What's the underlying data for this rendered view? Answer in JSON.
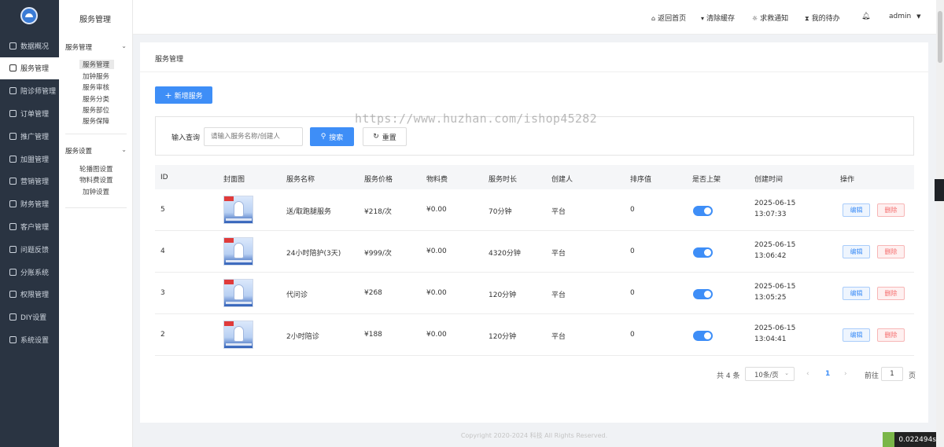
{
  "nav": {
    "items": [
      {
        "label": "数据概况",
        "icon": "dashboard-icon"
      },
      {
        "label": "服务管理",
        "icon": "service-icon"
      },
      {
        "label": "陪诊师管理",
        "icon": "doctor-icon"
      },
      {
        "label": "订单管理",
        "icon": "order-icon"
      },
      {
        "label": "推广管理",
        "icon": "promotion-icon"
      },
      {
        "label": "加盟管理",
        "icon": "franchise-icon"
      },
      {
        "label": "营销管理",
        "icon": "marketing-icon"
      },
      {
        "label": "财务管理",
        "icon": "finance-icon"
      },
      {
        "label": "客户管理",
        "icon": "customer-icon"
      },
      {
        "label": "问题反馈",
        "icon": "feedback-icon"
      },
      {
        "label": "分账系统",
        "icon": "split-icon"
      },
      {
        "label": "权限管理",
        "icon": "permission-icon"
      },
      {
        "label": "DIY设置",
        "icon": "diy-icon"
      },
      {
        "label": "系统设置",
        "icon": "settings-icon"
      }
    ],
    "active_index": 1
  },
  "subnav": {
    "title": "服务管理",
    "group1": {
      "label": "服务管理",
      "items": [
        "服务管理",
        "加钟服务",
        "服务审核",
        "服务分类",
        "服务部位",
        "服务保障"
      ]
    },
    "group2": {
      "label": "服务设置",
      "items": [
        "轮播图设置",
        "物料费设置",
        "加钟设置"
      ]
    }
  },
  "header": {
    "home": "返回首页",
    "clear_cache": "清除缓存",
    "help": "求救通知",
    "todo": "我的待办",
    "user": "admin"
  },
  "breadcrumb": "服务管理",
  "toolbar": {
    "add_label": "新增服务"
  },
  "search": {
    "label": "输入查询",
    "placeholder": "请输入服务名称/创建人",
    "search_label": "搜索",
    "reset_label": "重置"
  },
  "watermark": "https://www.huzhan.com/ishop45282",
  "table": {
    "columns": [
      "ID",
      "封面图",
      "服务名称",
      "服务价格",
      "物料费",
      "服务时长",
      "创建人",
      "排序值",
      "是否上架",
      "创建时间",
      "操作"
    ],
    "rows": [
      {
        "id": "5",
        "name": "送/取跑腿服务",
        "price": "¥218/次",
        "material": "¥0.00",
        "duration": "70分钟",
        "creator": "平台",
        "sort": "0",
        "date": "2025-06-15",
        "time": "13:07:33"
      },
      {
        "id": "4",
        "name": "24小时陪护(3天)",
        "price": "¥999/次",
        "material": "¥0.00",
        "duration": "4320分钟",
        "creator": "平台",
        "sort": "0",
        "date": "2025-06-15",
        "time": "13:06:42"
      },
      {
        "id": "3",
        "name": "代问诊",
        "price": "¥268",
        "material": "¥0.00",
        "duration": "120分钟",
        "creator": "平台",
        "sort": "0",
        "date": "2025-06-15",
        "time": "13:05:25"
      },
      {
        "id": "2",
        "name": "2小时陪诊",
        "price": "¥188",
        "material": "¥0.00",
        "duration": "120分钟",
        "creator": "平台",
        "sort": "0",
        "date": "2025-06-15",
        "time": "13:04:41"
      }
    ],
    "edit_label": "编辑",
    "delete_label": "删除"
  },
  "pagination": {
    "total": "共 4 条",
    "page_size": "10条/页",
    "current": "1",
    "goto_prefix": "前往",
    "goto_value": "1",
    "goto_suffix": "页"
  },
  "footer": "Copyright 2020-2024 科技 All Rights Reserved.",
  "timer": "0.022494s",
  "colors": {
    "primary": "#3e8ef7",
    "sidebar": "#2a3442",
    "danger": "#f56c6c"
  }
}
